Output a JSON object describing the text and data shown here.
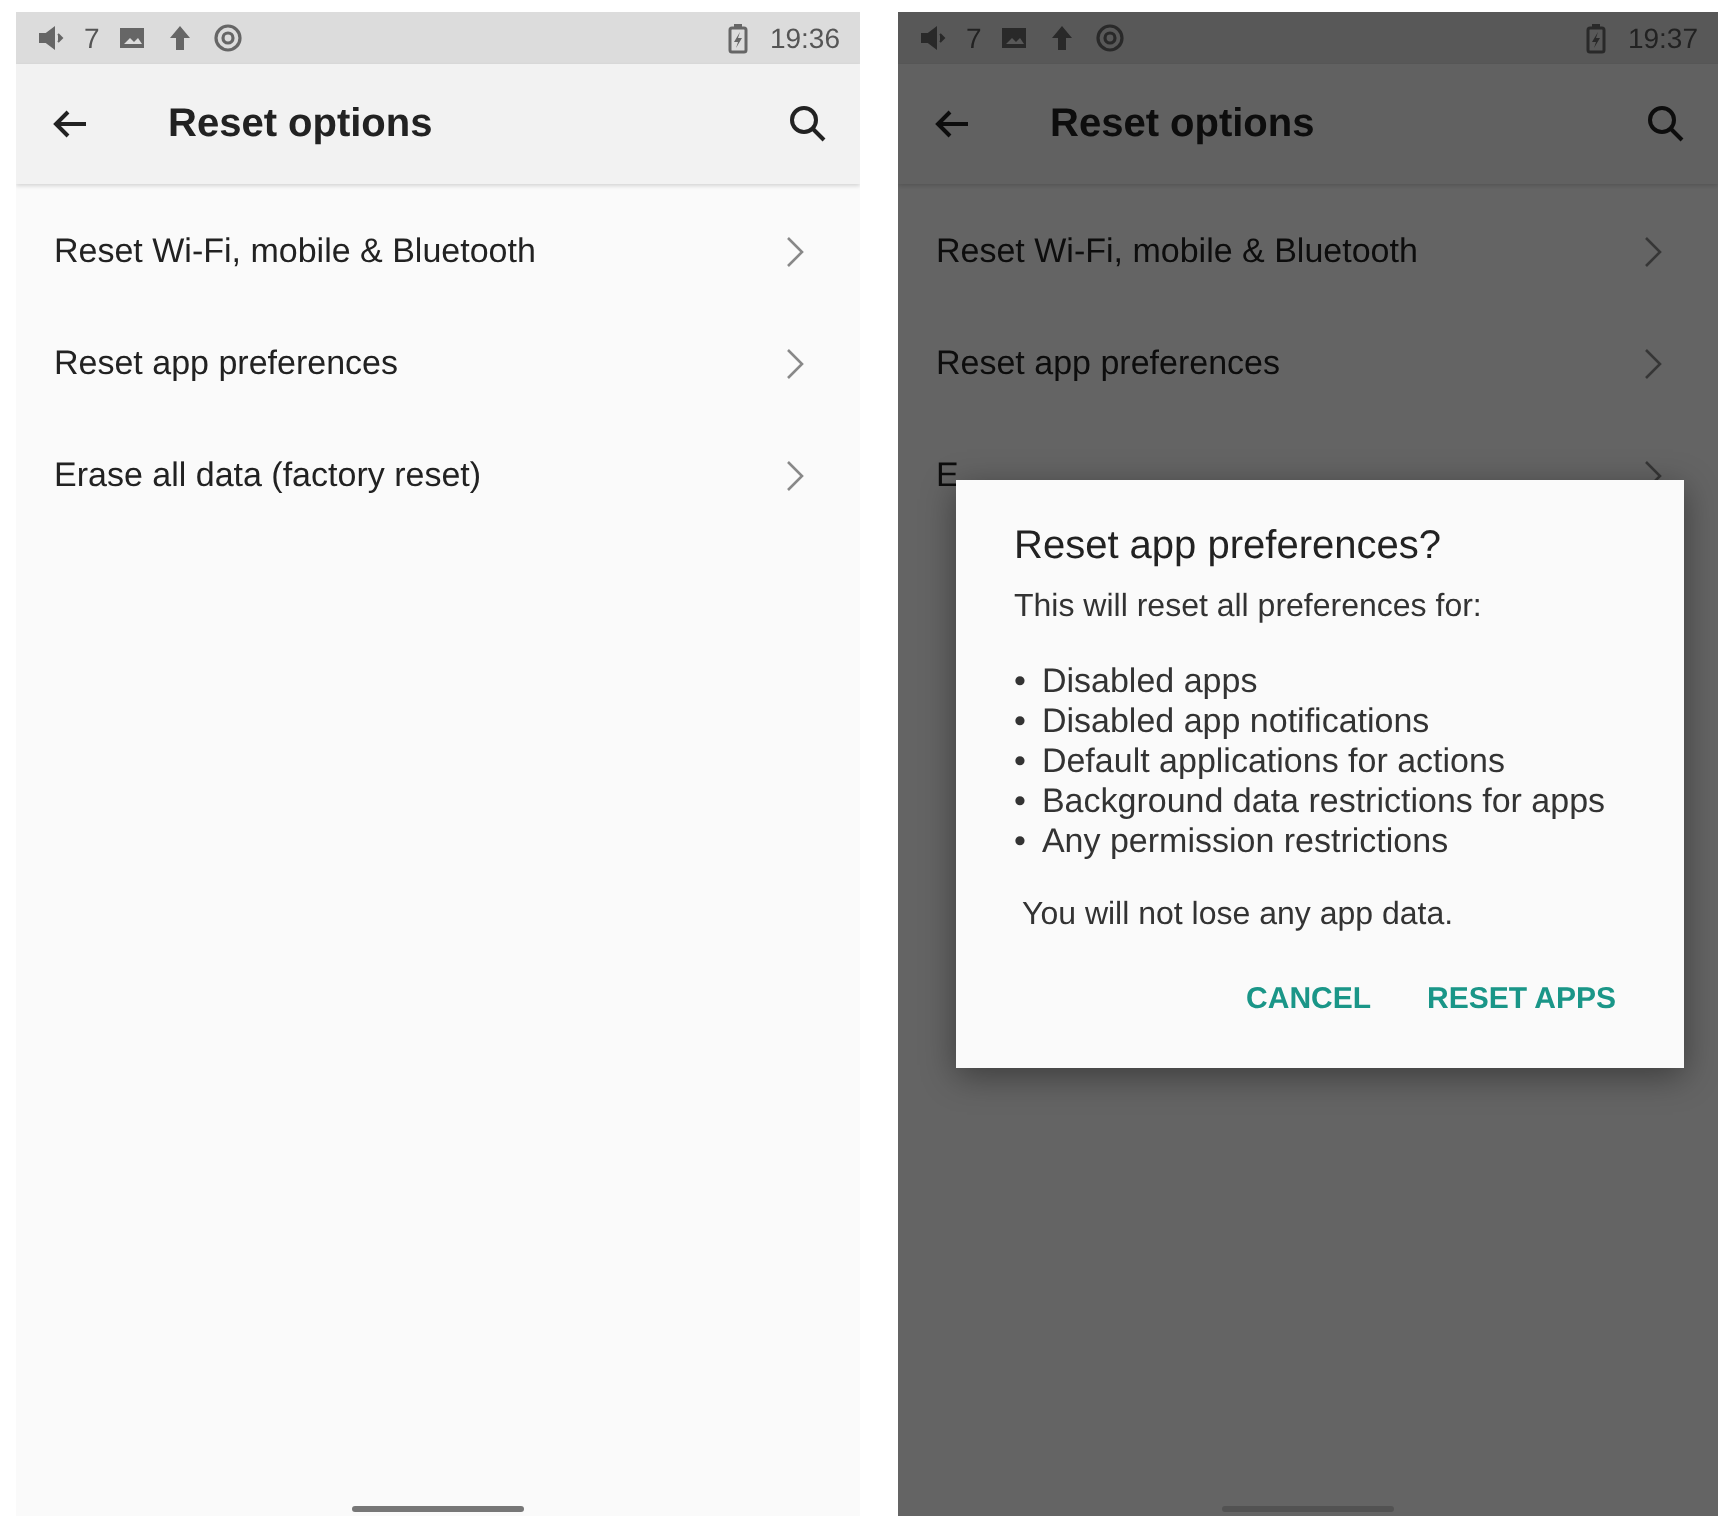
{
  "screens": [
    {
      "status_bar": {
        "notification_count": "7",
        "time": "19:36"
      },
      "app_bar": {
        "title": "Reset options"
      },
      "items": [
        {
          "label": "Reset Wi-Fi, mobile & Bluetooth"
        },
        {
          "label": "Reset app preferences"
        },
        {
          "label": "Erase all data (factory reset)"
        }
      ],
      "dimmed": false
    },
    {
      "status_bar": {
        "notification_count": "7",
        "time": "19:37"
      },
      "app_bar": {
        "title": "Reset options"
      },
      "items": [
        {
          "label": "Reset Wi-Fi, mobile & Bluetooth"
        },
        {
          "label": "Reset app preferences"
        },
        {
          "label": "E"
        }
      ],
      "dimmed": true,
      "dialog": {
        "title": "Reset app preferences?",
        "intro": "This will reset all preferences for:",
        "bullet_mark": "•",
        "bullets": [
          "Disabled apps",
          "Disabled app notifications",
          "Default applications for actions",
          "Background data restrictions for apps",
          "Any permission restrictions"
        ],
        "note": "You will not lose any app data.",
        "buttons": [
          "CANCEL",
          "RESET APPS"
        ]
      }
    }
  ]
}
